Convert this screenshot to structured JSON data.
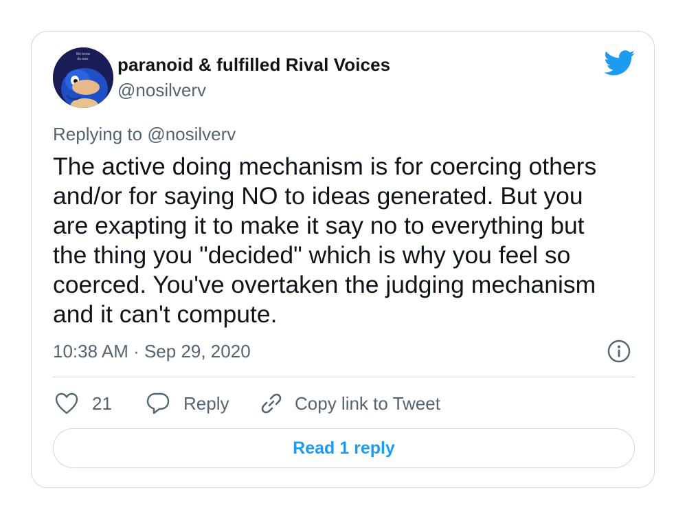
{
  "author": {
    "name": "paranoid & fulfilled Rival Voices",
    "handle": "@nosilverv",
    "avatar_caption": "We know da wae."
  },
  "reply_context": {
    "prefix": "Replying to ",
    "handle": "@nosilverv"
  },
  "tweet": {
    "text": "The active doing mechanism is for coercing others and/or for saying NO to ideas generated. But you are exapting it to make it say no to everything but the thing you \"decided\" which is why you feel so coerced. You've overtaken the judging mechanism and it can't compute.",
    "timestamp": "10:38 AM · Sep 29, 2020"
  },
  "actions": {
    "like_count": "21",
    "reply_label": "Reply",
    "copy_link_label": "Copy link to Tweet"
  },
  "read_replies_label": "Read 1 reply",
  "icons": {
    "brand": "twitter-bird-icon",
    "info": "info-icon",
    "like": "heart-icon",
    "reply": "speech-bubble-icon",
    "copy": "link-icon"
  },
  "colors": {
    "accent": "#1d9bf0",
    "text_primary": "#0f1419",
    "text_secondary": "#536471",
    "border": "#cfd9de"
  }
}
